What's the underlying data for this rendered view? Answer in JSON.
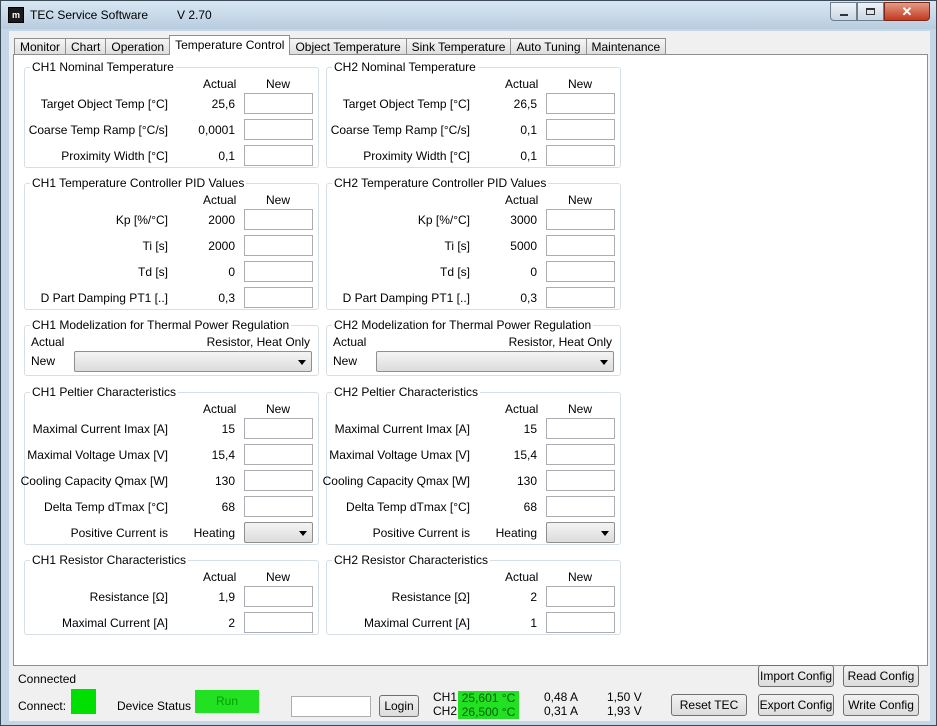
{
  "window": {
    "title": "TEC Service Software",
    "version": "V 2.70",
    "app_icon": "m-logo-icon"
  },
  "tabs": [
    {
      "label": "Monitor"
    },
    {
      "label": "Chart"
    },
    {
      "label": "Operation"
    },
    {
      "label": "Temperature Control",
      "active": true
    },
    {
      "label": "Object Temperature"
    },
    {
      "label": "Sink Temperature"
    },
    {
      "label": "Auto Tuning"
    },
    {
      "label": "Maintenance"
    }
  ],
  "headers": {
    "actual": "Actual",
    "new": "New"
  },
  "ch1": {
    "nominal": {
      "title": "CH1 Nominal Temperature",
      "rows": [
        {
          "label": "Target Object Temp [°C]",
          "actual": "25,6"
        },
        {
          "label": "Coarse Temp Ramp [°C/s]",
          "actual": "0,0001"
        },
        {
          "label": "Proximity Width [°C]",
          "actual": "0,1"
        }
      ]
    },
    "pid": {
      "title": "CH1 Temperature Controller PID Values",
      "rows": [
        {
          "label": "Kp [%/°C]",
          "actual": "2000"
        },
        {
          "label": "Ti [s]",
          "actual": "2000"
        },
        {
          "label": "Td [s]",
          "actual": "0"
        },
        {
          "label": "D Part Damping PT1 [..]",
          "actual": "0,3"
        }
      ]
    },
    "model": {
      "title": "CH1 Modelization for Thermal Power Regulation",
      "actual_label": "Actual",
      "actual_value": "Resistor, Heat Only",
      "new_label": "New"
    },
    "peltier": {
      "title": "CH1 Peltier Characteristics",
      "rows": [
        {
          "label": "Maximal Current Imax [A]",
          "actual": "15"
        },
        {
          "label": "Maximal Voltage Umax [V]",
          "actual": "15,4"
        },
        {
          "label": "Cooling Capacity Qmax [W]",
          "actual": "130"
        },
        {
          "label": "Delta Temp dTmax [°C]",
          "actual": "68"
        }
      ],
      "positive_label": "Positive Current is",
      "positive_actual": "Heating"
    },
    "resistor": {
      "title": "CH1 Resistor Characteristics",
      "rows": [
        {
          "label": "Resistance [Ω]",
          "actual": "1,9"
        },
        {
          "label": "Maximal Current [A]",
          "actual": "2"
        }
      ]
    }
  },
  "ch2": {
    "nominal": {
      "title": "CH2 Nominal Temperature",
      "rows": [
        {
          "label": "Target Object Temp [°C]",
          "actual": "26,5"
        },
        {
          "label": "Coarse Temp Ramp [°C/s]",
          "actual": "0,1"
        },
        {
          "label": "Proximity Width [°C]",
          "actual": "0,1"
        }
      ]
    },
    "pid": {
      "title": "CH2 Temperature Controller PID Values",
      "rows": [
        {
          "label": "Kp [%/°C]",
          "actual": "3000"
        },
        {
          "label": "Ti [s]",
          "actual": "5000"
        },
        {
          "label": "Td [s]",
          "actual": "0"
        },
        {
          "label": "D Part Damping PT1 [..]",
          "actual": "0,3"
        }
      ]
    },
    "model": {
      "title": "CH2 Modelization for Thermal Power Regulation",
      "actual_label": "Actual",
      "actual_value": "Resistor, Heat Only",
      "new_label": "New"
    },
    "peltier": {
      "title": "CH2 Peltier Characteristics",
      "rows": [
        {
          "label": "Maximal Current Imax [A]",
          "actual": "15"
        },
        {
          "label": "Maximal Voltage Umax [V]",
          "actual": "15,4"
        },
        {
          "label": "Cooling Capacity Qmax [W]",
          "actual": "130"
        },
        {
          "label": "Delta Temp dTmax [°C]",
          "actual": "68"
        }
      ],
      "positive_label": "Positive Current is",
      "positive_actual": "Heating"
    },
    "resistor": {
      "title": "CH2 Resistor Characteristics",
      "rows": [
        {
          "label": "Resistance [Ω]",
          "actual": "2"
        },
        {
          "label": "Maximal Current [A]",
          "actual": "1"
        }
      ]
    }
  },
  "status": {
    "connected": "Connected",
    "connect_label": "Connect:",
    "device_status_label": "Device Status",
    "device_status": "Run",
    "login": "Login",
    "ch1_label": "CH1",
    "ch1_temp": "25,601 °C",
    "ch1_current": "0,48 A",
    "ch1_voltage": "1,50 V",
    "ch2_label": "CH2",
    "ch2_temp": "26,500 °C",
    "ch2_current": "0,31 A",
    "ch2_voltage": "1,93 V"
  },
  "buttons": {
    "import_config": "Import Config",
    "read_config": "Read Config",
    "reset_tec": "Reset TEC",
    "export_config": "Export Config",
    "write_config": "Write Config"
  },
  "colors": {
    "led_green": "#00e000",
    "status_green": "#22e022"
  }
}
